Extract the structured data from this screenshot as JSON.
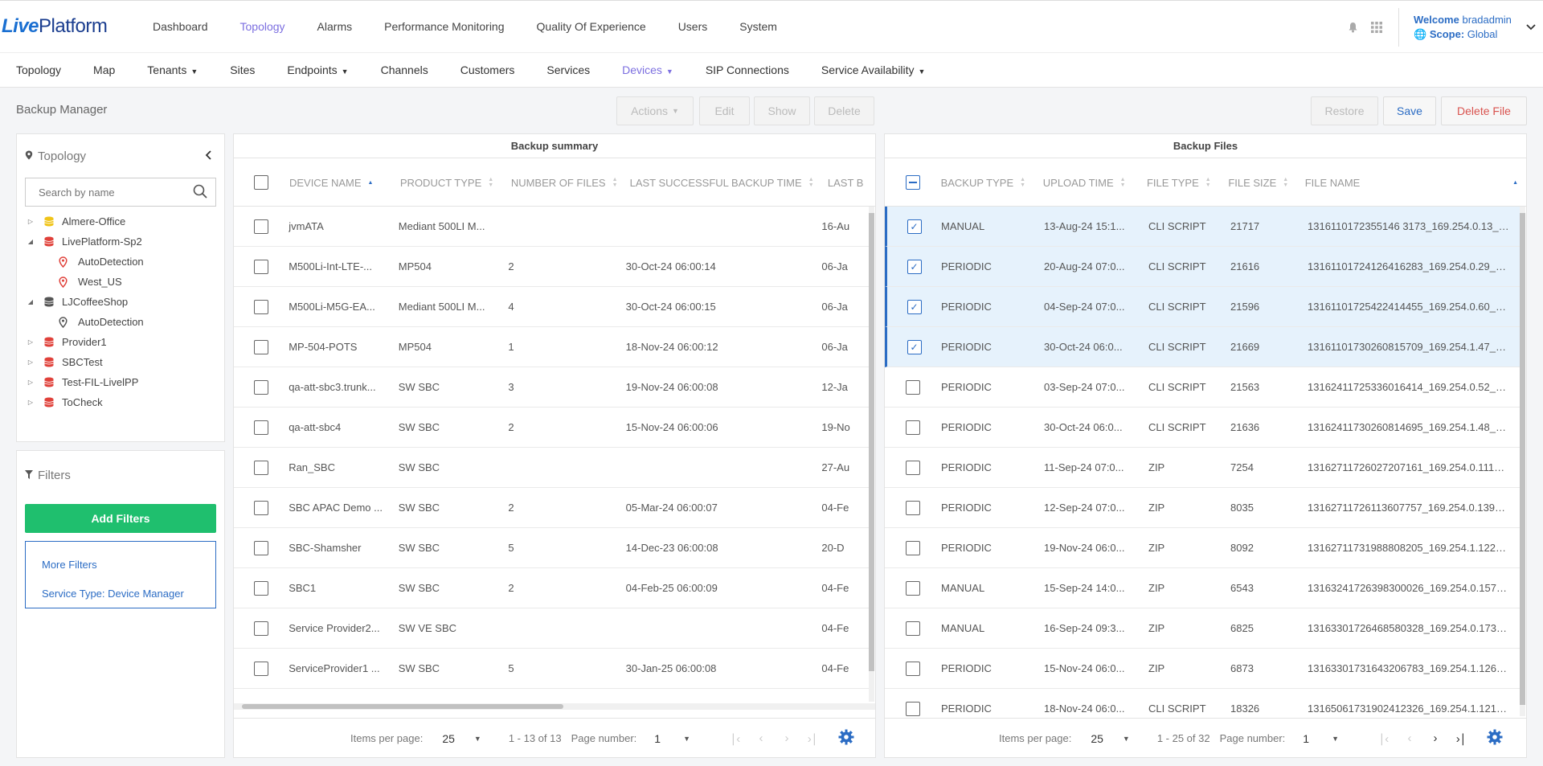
{
  "app": {
    "logo_part1": "Live",
    "logo_part2": "Platform"
  },
  "top_nav": [
    "Dashboard",
    "Topology",
    "Alarms",
    "Performance Monitoring",
    "Quality Of Experience",
    "Users",
    "System"
  ],
  "user": {
    "welcome_label": "Welcome",
    "username": "bradadmin",
    "scope_label": "Scope:",
    "scope_value": "Global"
  },
  "sub_nav": [
    "Topology",
    "Map",
    "Tenants",
    "Sites",
    "Endpoints",
    "Channels",
    "Customers",
    "Services",
    "Devices",
    "SIP Connections",
    "Service Availability"
  ],
  "page": {
    "title": "Backup Manager"
  },
  "toolbar": {
    "actions": "Actions",
    "edit": "Edit",
    "show": "Show",
    "delete": "Delete",
    "restore": "Restore",
    "save": "Save",
    "delete_file": "Delete File"
  },
  "topology_panel": {
    "title": "Topology",
    "search_placeholder": "Search by name",
    "tree": [
      {
        "label": "Almere-Office",
        "level": 0,
        "expanded": false,
        "icon": "db-yellow"
      },
      {
        "label": "LivePlatform-Sp2",
        "level": 0,
        "expanded": true,
        "icon": "db-red"
      },
      {
        "label": "AutoDetection",
        "level": 1,
        "icon": "pin-red"
      },
      {
        "label": "West_US",
        "level": 1,
        "icon": "pin-red"
      },
      {
        "label": "LJCoffeeShop",
        "level": 0,
        "expanded": true,
        "icon": "db-gray"
      },
      {
        "label": "AutoDetection",
        "level": 1,
        "icon": "pin-gray"
      },
      {
        "label": "Provider1",
        "level": 0,
        "expanded": false,
        "icon": "db-red"
      },
      {
        "label": "SBCTest",
        "level": 0,
        "expanded": false,
        "icon": "db-red"
      },
      {
        "label": "Test-FIL-LivelPP",
        "level": 0,
        "expanded": false,
        "icon": "db-red"
      },
      {
        "label": "ToCheck",
        "level": 0,
        "expanded": false,
        "icon": "db-red"
      }
    ]
  },
  "filters_panel": {
    "title": "Filters",
    "add_button": "Add Filters",
    "more_filters": "More Filters",
    "service_type": "Service Type: Device Manager"
  },
  "backup_summary": {
    "title": "Backup summary",
    "columns": [
      "DEVICE NAME",
      "PRODUCT TYPE",
      "NUMBER OF FILES",
      "LAST SUCCESSFUL BACKUP TIME",
      "LAST B"
    ],
    "rows": [
      [
        "jvmATA",
        "Mediant 500LI M...",
        "",
        "",
        "16-Au"
      ],
      [
        "M500Li-Int-LTE-...",
        "MP504",
        "2",
        "30-Oct-24 06:00:14",
        "06-Ja"
      ],
      [
        "M500Li-M5G-EA...",
        "Mediant 500LI M...",
        "4",
        "30-Oct-24 06:00:15",
        "06-Ja"
      ],
      [
        "MP-504-POTS",
        "MP504",
        "1",
        "18-Nov-24 06:00:12",
        "06-Ja"
      ],
      [
        "qa-att-sbc3.trunk...",
        "SW SBC",
        "3",
        "19-Nov-24 06:00:08",
        "12-Ja"
      ],
      [
        "qa-att-sbc4",
        "SW SBC",
        "2",
        "15-Nov-24 06:00:06",
        "19-No"
      ],
      [
        "Ran_SBC",
        "SW SBC",
        "",
        "",
        "27-Au"
      ],
      [
        "SBC APAC Demo ...",
        "SW SBC",
        "2",
        "05-Mar-24 06:00:07",
        "04-Fe"
      ],
      [
        "SBC-Shamsher",
        "SW SBC",
        "5",
        "14-Dec-23 06:00:08",
        "20-D"
      ],
      [
        "SBC1",
        "SW SBC",
        "2",
        "04-Feb-25 06:00:09",
        "04-Fe"
      ],
      [
        "Service Provider2...",
        "SW VE SBC",
        "",
        "",
        "04-Fe"
      ],
      [
        "ServiceProvider1 ...",
        "SW SBC",
        "5",
        "30-Jan-25 06:00:08",
        "04-Fe"
      ]
    ],
    "pager": {
      "items_label": "Items per page:",
      "items_value": "25",
      "range": "1 - 13 of 13",
      "page_label": "Page number:",
      "page_value": "1"
    }
  },
  "backup_files": {
    "title": "Backup Files",
    "columns": [
      "BACKUP TYPE",
      "UPLOAD TIME",
      "FILE TYPE",
      "FILE SIZE",
      "FILE NAME"
    ],
    "rows": [
      {
        "cells": [
          "MANUAL",
          "13-Aug-24 15:1...",
          "CLI SCRIPT",
          "21717",
          "1316110172355146 3173_169.254.0.13_13..."
        ],
        "checked": true
      },
      {
        "cells": [
          "PERIODIC",
          "20-Aug-24 07:0...",
          "CLI SCRIPT",
          "21616",
          "131611017241264 16283_169.254.0.29_13..."
        ],
        "checked": true
      },
      {
        "cells": [
          "PERIODIC",
          "04-Sep-24 07:0...",
          "CLI SCRIPT",
          "21596",
          "131611017254224 14455_169.254.0.60_13..."
        ],
        "checked": true
      },
      {
        "cells": [
          "PERIODIC",
          "30-Oct-24 06:0...",
          "CLI SCRIPT",
          "21669",
          "131611017302608 15709_169.254.1.47_131..."
        ],
        "checked": true
      },
      {
        "cells": [
          "PERIODIC",
          "03-Sep-24 07:0...",
          "CLI SCRIPT",
          "21563",
          "131624117253360 16414_169.254.0.52_13..."
        ],
        "checked": false
      },
      {
        "cells": [
          "PERIODIC",
          "30-Oct-24 06:0...",
          "CLI SCRIPT",
          "21636",
          "131624117302608 14695_169.254.1.48_13..."
        ],
        "checked": false
      },
      {
        "cells": [
          "PERIODIC",
          "11-Sep-24 07:0...",
          "ZIP",
          "7254",
          "131627117260272 07161_169.254.0.111_13..."
        ],
        "checked": false
      },
      {
        "cells": [
          "PERIODIC",
          "12-Sep-24 07:0...",
          "ZIP",
          "8035",
          "131627117261136 07757_169.254.0.139_13..."
        ],
        "checked": false
      },
      {
        "cells": [
          "PERIODIC",
          "19-Nov-24 06:0...",
          "ZIP",
          "8092",
          "131627117319888 08205_169.254.1.122_1..."
        ],
        "checked": false
      },
      {
        "cells": [
          "MANUAL",
          "15-Sep-24 14:0...",
          "ZIP",
          "6543",
          "131632417263983 00026_169.254.0.157_1..."
        ],
        "checked": false
      },
      {
        "cells": [
          "MANUAL",
          "16-Sep-24 09:3...",
          "ZIP",
          "6825",
          "131633017264685 80328_169.254.0.173_..."
        ],
        "checked": false
      },
      {
        "cells": [
          "PERIODIC",
          "15-Nov-24 06:0...",
          "ZIP",
          "6873",
          "131633017316432 06783_169.254.1.126_1..."
        ],
        "checked": false
      },
      {
        "cells": [
          "PERIODIC",
          "18-Nov-24 06:0...",
          "CLI SCRIPT",
          "18326",
          "131650617319024 12326_169.254.1.121_1..."
        ],
        "checked": false
      }
    ],
    "pager": {
      "items_label": "Items per page:",
      "items_value": "25",
      "range": "1 - 25 of 32",
      "page_label": "Page number:",
      "page_value": "1"
    }
  },
  "colors": {
    "accent": "#7c6fe0",
    "link": "#2b6cc4",
    "green": "#1fbf6e",
    "danger": "#d9534f"
  }
}
